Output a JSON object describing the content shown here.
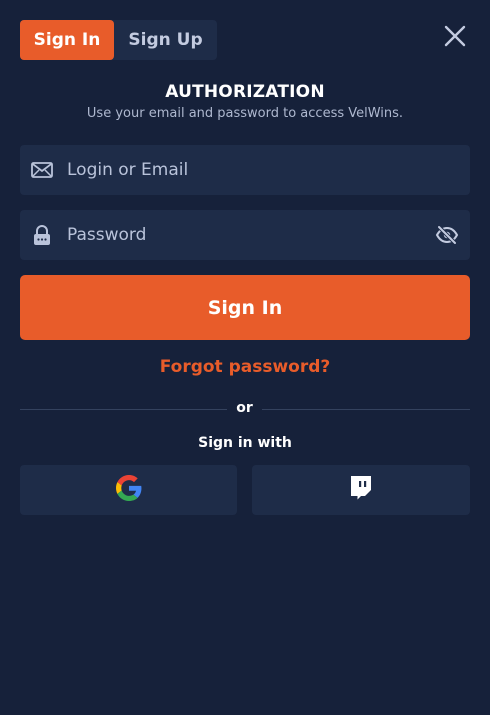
{
  "tabs": {
    "signin_label": "Sign In",
    "signup_label": "Sign Up"
  },
  "header": {
    "title": "AUTHORIZATION",
    "subtitle": "Use your email and password to access VelWins."
  },
  "form": {
    "login_placeholder": "Login or Email",
    "login_value": "",
    "password_placeholder": "Password",
    "password_value": "",
    "submit_label": "Sign In"
  },
  "links": {
    "forgot_label": "Forgot password?"
  },
  "divider": {
    "or_label": "or"
  },
  "social": {
    "heading": "Sign in with",
    "providers": [
      {
        "name": "google-icon"
      },
      {
        "name": "twitch-icon"
      }
    ]
  },
  "colors": {
    "background": "#16213a",
    "surface": "#1e2c48",
    "accent": "#e85c2a",
    "muted_text": "#aeb8cf"
  },
  "icons": {
    "close": "close-icon",
    "email": "envelope-icon",
    "password": "lock-icon",
    "toggle_visibility": "eye-slash-icon"
  }
}
